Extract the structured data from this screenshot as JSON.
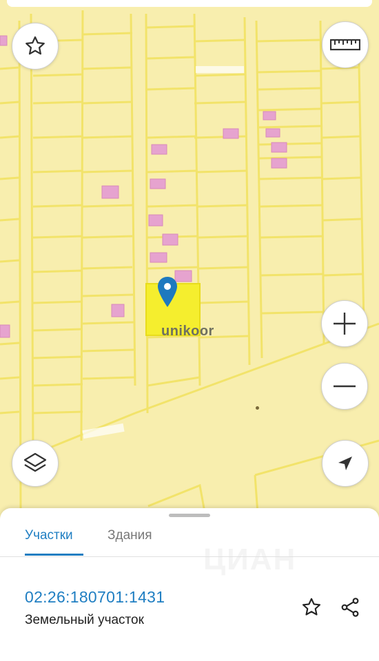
{
  "map": {
    "brand": "unikoor",
    "colors": {
      "background": "#f8eeae",
      "parcel_line": "#f2e36a",
      "building_fill": "#e6a3cf",
      "selected_fill": "#f5ee2e",
      "pin": "#1e79bf"
    },
    "controls": {
      "favorite_icon": "star-icon",
      "ruler_icon": "ruler-icon",
      "zoom_in_icon": "plus-icon",
      "zoom_out_icon": "minus-icon",
      "layers_icon": "layers-icon",
      "location_icon": "navigation-arrow-icon"
    }
  },
  "sheet": {
    "tabs": [
      {
        "label": "Участки",
        "active": true
      },
      {
        "label": "Здания",
        "active": false
      }
    ],
    "parcel": {
      "cadastral_number": "02:26:180701:1431",
      "type": "Земельный участок"
    },
    "actions": {
      "favorite_icon": "star-icon",
      "share_icon": "share-icon"
    },
    "watermark": "ЦИАН"
  }
}
